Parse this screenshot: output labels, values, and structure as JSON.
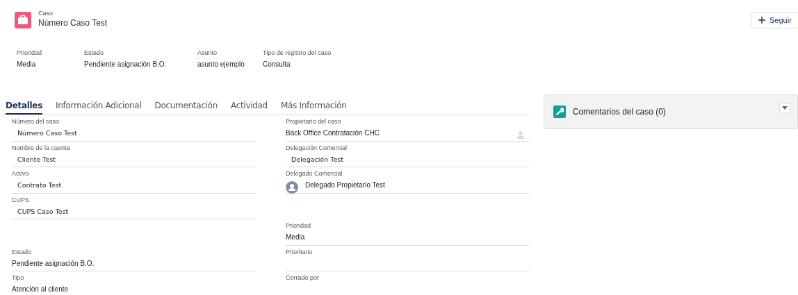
{
  "header": {
    "object_label": "Caso",
    "title": "Número Caso Test",
    "follow_button": "Seguir"
  },
  "highlights": [
    {
      "label": "Prioridad",
      "value": "Media"
    },
    {
      "label": "Estado",
      "value": "Pendiente asignación B.O."
    },
    {
      "label": "Asunto",
      "value": "asunto ejemplo"
    },
    {
      "label": "Tipo de registro del caso",
      "value": "Consulta"
    }
  ],
  "tabs": [
    {
      "label": "Detalles",
      "selected": true
    },
    {
      "label": "Información Adicional",
      "selected": false
    },
    {
      "label": "Documentación",
      "selected": false
    },
    {
      "label": "Actividad",
      "selected": false
    },
    {
      "label": "Más Información",
      "selected": false
    }
  ],
  "detail_rows": [
    {
      "left": {
        "label": "Número del caso",
        "value": "Número Caso Test",
        "kind": "lookup"
      },
      "right": {
        "label": "Propietario del caso",
        "value": "Back Office Contratación CHC",
        "kind": "owner"
      }
    },
    {
      "left": {
        "label": "Nombre de la cuenta",
        "value": "Cliente Test",
        "kind": "lookup"
      },
      "right": {
        "label": "Delegación Comercial",
        "value": "Delegación Test",
        "kind": "lookup"
      }
    },
    {
      "left": {
        "label": "Activo",
        "value": "Contrato Test",
        "kind": "lookup"
      },
      "right": {
        "label": "Delegado Comercial",
        "value": "Delegado Propietario  Test",
        "kind": "user"
      }
    },
    {
      "left": {
        "label": "CUPS",
        "value": "CUPS Caso Test",
        "kind": "lookup"
      }
    },
    {
      "right": {
        "label": "Prioridad",
        "value": "Media",
        "kind": "text"
      }
    },
    {
      "left": {
        "label": "Estado",
        "value": "Pendiente asignación B.O.",
        "kind": "text"
      },
      "right": {
        "label": "Prioritario"
      }
    },
    {
      "left": {
        "label": "Tipo",
        "value": "Atención al cliente",
        "kind": "text"
      },
      "right": {
        "label": "Cerrado por"
      }
    }
  ],
  "side_panel": {
    "title": "Comentarios del caso (0)"
  }
}
